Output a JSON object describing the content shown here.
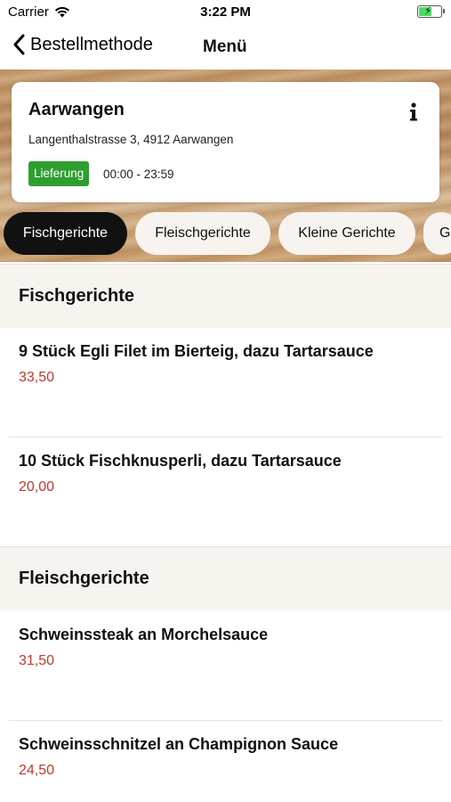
{
  "status_bar": {
    "carrier": "Carrier",
    "time": "3:22 PM",
    "battery_level": 0.6
  },
  "nav": {
    "back_label": "Bestellmethode",
    "title": "Menü"
  },
  "restaurant": {
    "name": "Aarwangen",
    "address": "Langenthalstrasse 3, 4912 Aarwangen",
    "delivery_badge": "Lieferung",
    "hours": "00:00 - 23:59"
  },
  "categories": [
    {
      "label": "Fischgerichte",
      "active": true
    },
    {
      "label": "Fleischgerichte",
      "active": false
    },
    {
      "label": "Kleine Gerichte",
      "active": false
    },
    {
      "label": "G",
      "active": false
    }
  ],
  "sections": [
    {
      "title": "Fischgerichte",
      "items": [
        {
          "name": "9 Stück Egli Filet im Bierteig, dazu Tartarsauce",
          "price": "33,50"
        },
        {
          "name": "10 Stück Fischknusperli, dazu Tartarsauce",
          "price": "20,00"
        }
      ]
    },
    {
      "title": "Fleischgerichte",
      "items": [
        {
          "name": "Schweinssteak an Morchelsauce",
          "price": "31,50"
        },
        {
          "name": "Schweinsschnitzel an Champignon Sauce",
          "price": "24,50"
        }
      ]
    }
  ],
  "colors": {
    "accent_price": "#c0392b",
    "badge_green": "#2e9e2f",
    "chip_active": "#111111"
  }
}
